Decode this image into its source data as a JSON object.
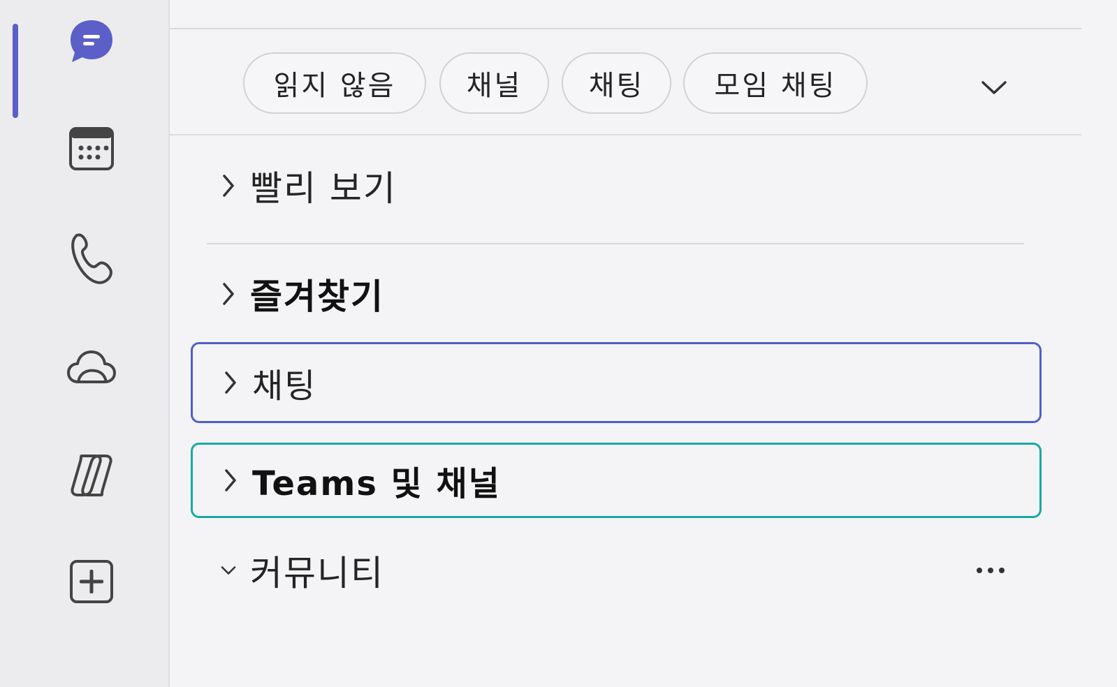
{
  "app_rail": {
    "items": [
      {
        "name": "chat",
        "icon": "chat-icon",
        "active": true
      },
      {
        "name": "calendar",
        "icon": "calendar-icon",
        "active": false
      },
      {
        "name": "calls",
        "icon": "phone-icon",
        "active": false
      },
      {
        "name": "onedrive",
        "icon": "cloud-icon",
        "active": false
      },
      {
        "name": "copilot",
        "icon": "copilot-icon",
        "active": false
      },
      {
        "name": "apps",
        "icon": "add-apps-icon",
        "active": false
      }
    ],
    "accent_color": "#5b5fc7"
  },
  "filters": {
    "chips": [
      "읽지 않음",
      "채널",
      "채팅",
      "모임 채팅"
    ],
    "expand_icon": "chevron-down-icon"
  },
  "sections": [
    {
      "label": "빨리 보기",
      "expanded": false,
      "bold": false
    },
    {
      "label": "즐겨찾기",
      "expanded": false,
      "bold": true
    },
    {
      "label": "채팅",
      "expanded": false,
      "bold": false
    },
    {
      "label": "Teams 및 채널",
      "expanded": false,
      "bold": true
    },
    {
      "label": "커뮤니티",
      "expanded": true,
      "bold": false,
      "more_icon": "more-options-icon"
    }
  ],
  "colors": {
    "focus_blue": "#4f5fc9",
    "focus_teal": "#18a8a6"
  }
}
